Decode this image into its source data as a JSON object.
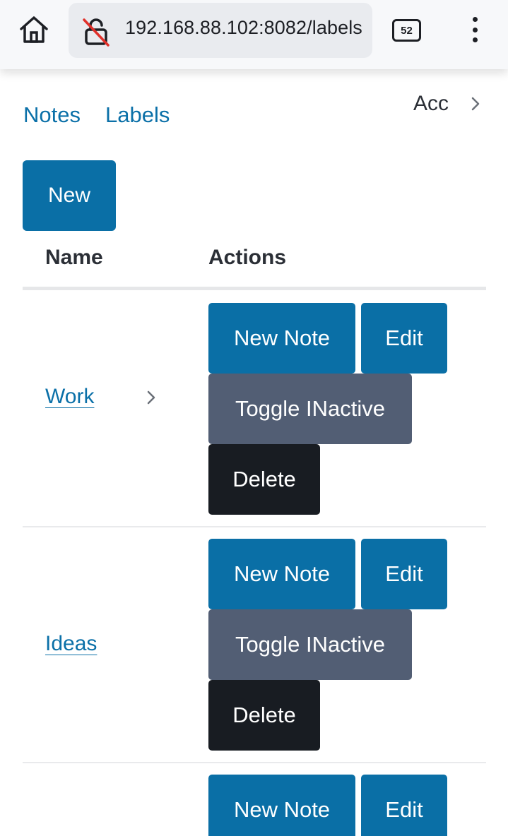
{
  "browser": {
    "url": "192.168.88.102:8082/labels",
    "tab_count": "52",
    "home_icon": "home-icon",
    "lock_icon": "insecure-lock-icon",
    "menu_icon": "more-vert-icon"
  },
  "nav": {
    "notes_label": "Notes",
    "labels_label": "Labels",
    "account_label": "Acc"
  },
  "toolbar": {
    "new_label": "New"
  },
  "table": {
    "headers": {
      "name": "Name",
      "actions": "Actions"
    },
    "rows": [
      {
        "label": "Work",
        "new_note": "New Note",
        "edit": "Edit",
        "toggle": "Toggle INactive",
        "delete": "Delete"
      },
      {
        "label": "Ideas",
        "new_note": "New Note",
        "edit": "Edit",
        "toggle": "Toggle INactive",
        "delete": "Delete"
      },
      {
        "label": "",
        "new_note": "New Note",
        "edit": "Edit"
      }
    ]
  },
  "colors": {
    "primary": "#0a6fa6",
    "secondary": "#525e74",
    "dark": "#181c22",
    "link": "#0b70a8"
  }
}
